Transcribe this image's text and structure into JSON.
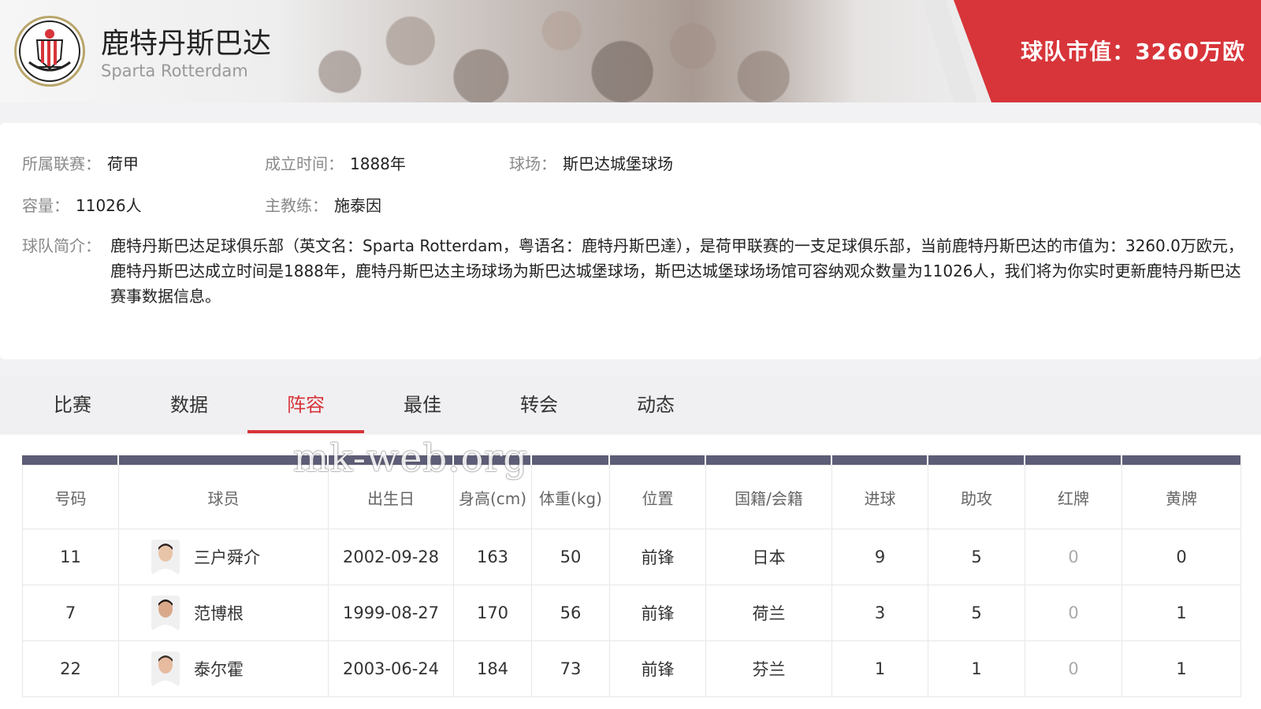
{
  "header": {
    "team_name": "鹿特丹斯巴达",
    "team_name_en": "Sparta Rotterdam",
    "market_value": "球队市值：3260万欧",
    "brand_red": "#d7353a"
  },
  "info": {
    "league_label": "所属联赛：",
    "league": "荷甲",
    "founded_label": "成立时间：",
    "founded": "1888年",
    "stadium_label": "球场：",
    "stadium": "斯巴达城堡球场",
    "capacity_label": "容量：",
    "capacity": "11026人",
    "coach_label": "主教练：",
    "coach": "施泰因",
    "intro_label": "球队简介：",
    "intro": "鹿特丹斯巴达足球俱乐部（英文名：Sparta Rotterdam，粤语名：鹿特丹斯巴達），是荷甲联赛的一支足球俱乐部，当前鹿特丹斯巴达的市值为：3260.0万欧元，鹿特丹斯巴达成立时间是1888年，鹿特丹斯巴达主场球场为斯巴达城堡球场，斯巴达城堡球场场馆可容纳观众数量为11026人，我们将为你实时更新鹿特丹斯巴达赛事数据信息。"
  },
  "tabs": [
    {
      "label": "比赛"
    },
    {
      "label": "数据"
    },
    {
      "label": "阵容",
      "active": true
    },
    {
      "label": "最佳"
    },
    {
      "label": "转会"
    },
    {
      "label": "动态"
    }
  ],
  "watermark": "mk-web.org",
  "roster": {
    "columns": [
      "号码",
      "球员",
      "出生日",
      "身高(cm)",
      "体重(kg)",
      "位置",
      "国籍/会籍",
      "进球",
      "助攻",
      "红牌",
      "黄牌"
    ],
    "rows": [
      {
        "number": "11",
        "name": "三户舜介",
        "birth": "2002-09-28",
        "height": "163",
        "weight": "50",
        "position": "前锋",
        "nation": "日本",
        "goals": "9",
        "assists": "5",
        "red": "0",
        "yellow": "0",
        "avatar": "player-avatar-icon"
      },
      {
        "number": "7",
        "name": "范博根",
        "birth": "1999-08-27",
        "height": "170",
        "weight": "56",
        "position": "前锋",
        "nation": "荷兰",
        "goals": "3",
        "assists": "5",
        "red": "0",
        "yellow": "1",
        "avatar": "player-avatar-icon"
      },
      {
        "number": "22",
        "name": "泰尔霍",
        "birth": "2003-06-24",
        "height": "184",
        "weight": "73",
        "position": "前锋",
        "nation": "芬兰",
        "goals": "1",
        "assists": "1",
        "red": "0",
        "yellow": "1",
        "avatar": "player-avatar-icon"
      }
    ]
  }
}
